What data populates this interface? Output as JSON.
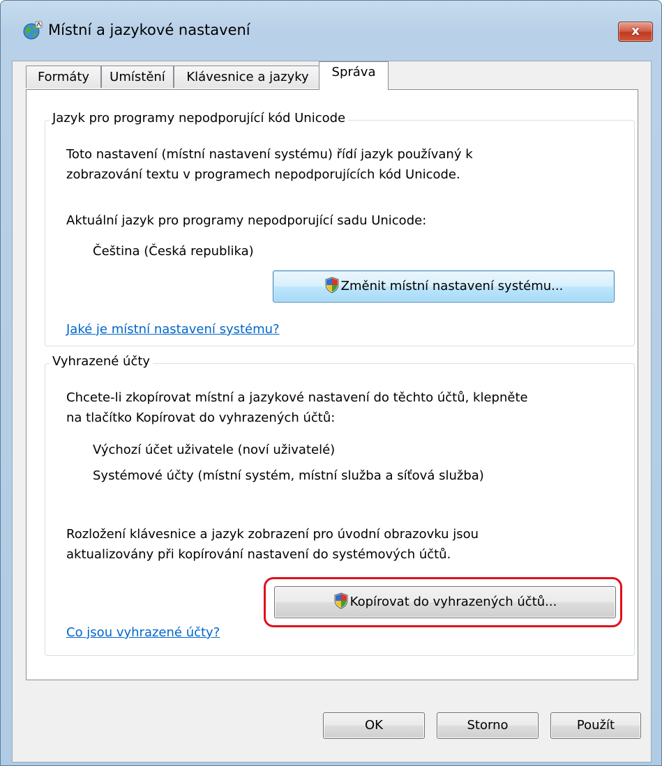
{
  "window": {
    "title": "Místní a jazykové nastavení",
    "close_label": "x"
  },
  "tabs": [
    {
      "label": "Formáty"
    },
    {
      "label": "Umístění"
    },
    {
      "label": "Klávesnice a jazyky"
    },
    {
      "label": "Správa",
      "active": true
    }
  ],
  "unicode_group": {
    "title": "Jazyk pro programy nepodporující kód Unicode",
    "desc_line1": "Toto nastavení (místní nastavení systému) řídí jazyk používaný k",
    "desc_line2": "zobrazování textu v programech nepodporujících kód Unicode.",
    "current_label": "Aktuální jazyk pro programy nepodporující sadu Unicode:",
    "current_value": "Čeština (Česká republika)",
    "change_button": "Změnit místní nastavení systému...",
    "help_link": "Jaké je místní nastavení systému?"
  },
  "reserved_group": {
    "title": "Vyhrazené účty",
    "desc_line1": "Chcete-li zkopírovat místní a jazykové nastavení do těchto účtů, klepněte",
    "desc_line2": "na tlačítko Kopírovat do vyhrazených účtů:",
    "account1": "Výchozí účet uživatele (noví uživatelé)",
    "account2": "Systémové účty (místní systém, místní služba a síťová služba)",
    "note_line1": "Rozložení klávesnice a jazyk zobrazení pro úvodní obrazovku jsou",
    "note_line2": "aktualizovány při kopírování nastavení do systémových účtů.",
    "copy_button": "Kopírovat do vyhrazených účtů...",
    "help_link": "Co jsou vyhrazené účty?"
  },
  "footer": {
    "ok": "OK",
    "cancel": "Storno",
    "apply": "Použít"
  },
  "colors": {
    "highlight": "#e0101a",
    "link": "#0066cc"
  }
}
